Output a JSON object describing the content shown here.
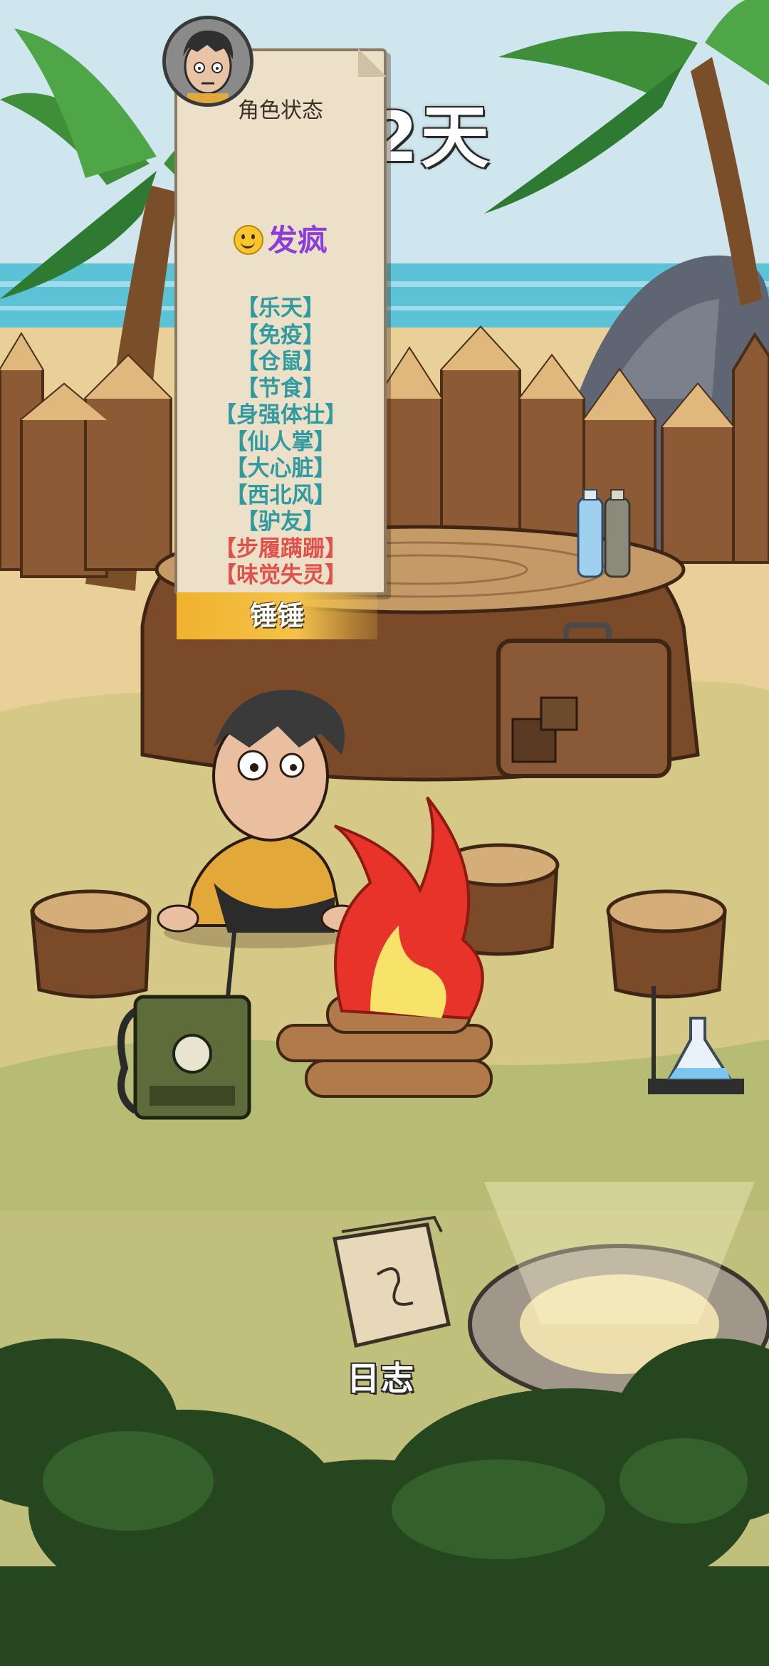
{
  "hud": {
    "day_counter": "2天"
  },
  "status_panel": {
    "title": "角色状态",
    "mood": "发疯",
    "traits_positive": [
      "【乐天】",
      "【免疫】",
      "【仓鼠】",
      "【节食】",
      "【身强体壮】",
      "【仙人掌】",
      "【大心脏】",
      "【西北风】",
      "【驴友】"
    ],
    "traits_negative": [
      "【步履蹒跚】",
      "【味觉失灵】"
    ],
    "character_name": "锤锤"
  },
  "journal": {
    "label": "日志"
  },
  "colors": {
    "trait_positive": "#2f9aa0",
    "trait_negative": "#e2504a",
    "mood": "#8b3fd8",
    "name_plate": "#f1b22d"
  }
}
